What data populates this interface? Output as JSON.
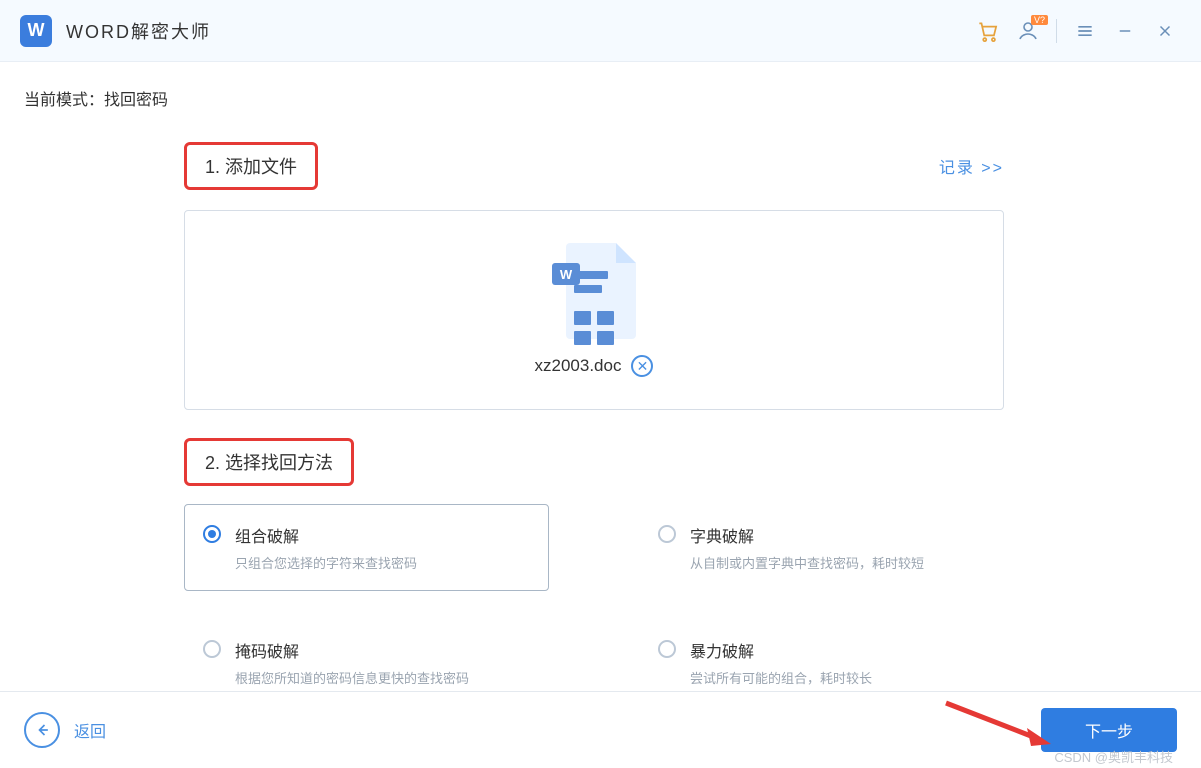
{
  "header": {
    "app_title": "WORD解密大师",
    "logo_letter": "W",
    "badge": "V?"
  },
  "mode": {
    "label_prefix": "当前模式：",
    "label_value": "找回密码"
  },
  "step1": {
    "title": "1. 添加文件",
    "records_link": "记录  >>",
    "file_name": "xz2003.doc"
  },
  "step2": {
    "title": "2. 选择找回方法"
  },
  "methods": [
    {
      "title": "组合破解",
      "desc": "只组合您选择的字符来查找密码",
      "selected": true
    },
    {
      "title": "字典破解",
      "desc": "从自制或内置字典中查找密码，耗时较短",
      "selected": false
    },
    {
      "title": "掩码破解",
      "desc": "根据您所知道的密码信息更快的查找密码",
      "selected": false
    },
    {
      "title": "暴力破解",
      "desc": "尝试所有可能的组合，耗时较长",
      "selected": false
    }
  ],
  "footer": {
    "back": "返回",
    "next": "下一步"
  },
  "watermark": "CSDN @奥凯丰科技"
}
